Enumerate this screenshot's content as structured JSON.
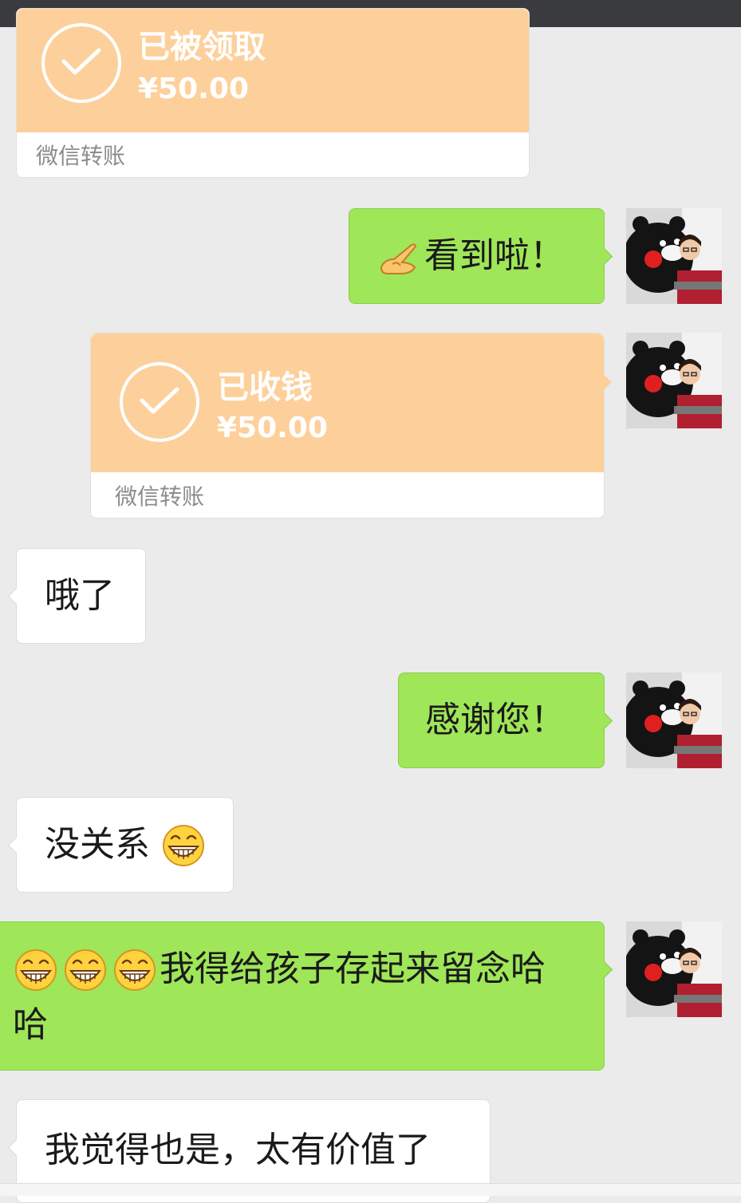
{
  "transfers": [
    {
      "status": "已被领取",
      "amount": "¥50.00",
      "label": "微信转账"
    },
    {
      "status": "已收钱",
      "amount": "¥50.00",
      "label": "微信转账"
    }
  ],
  "messages": [
    {
      "text": "看到啦！",
      "emoji": "ok-hand-emoji"
    },
    {
      "text": "哦了"
    },
    {
      "text": "感谢您！"
    },
    {
      "text": "没关系",
      "emoji": "grin-emoji"
    },
    {
      "text_line1": "我得给孩子存起来留念哈",
      "text_line2": "哈",
      "emoji": "grin-emoji x3"
    },
    {
      "text": "我觉得也是，太有价值了"
    }
  ],
  "colors": {
    "self_bubble": "#9fe658",
    "other_bubble": "#ffffff",
    "transfer_card": "#fdd09b",
    "background": "#ebebeb",
    "status_bar": "#3a3b3f"
  }
}
